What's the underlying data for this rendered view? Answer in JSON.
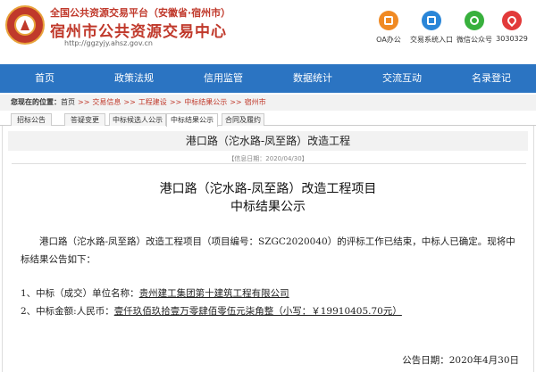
{
  "header": {
    "subtitle": "全国公共资源交易平台（安徽省·宿州市）",
    "title": "宿州市公共资源交易中心",
    "url": "http://ggzyjy.ahsz.gov.cn",
    "quick_links": [
      {
        "label": "OA办公",
        "icon": "office-icon",
        "color": "#f08a24"
      },
      {
        "label": "交易系统入口",
        "icon": "system-icon",
        "color": "#2a86d8"
      },
      {
        "label": "微信公众号",
        "icon": "wechat-icon",
        "color": "#38b03d"
      },
      {
        "label": "3030329",
        "icon": "phone-icon",
        "color": "#e23a3a"
      }
    ]
  },
  "nav": {
    "items": [
      "首页",
      "政策法规",
      "信用监管",
      "数据统计",
      "交流互动",
      "名录登记"
    ],
    "color": "#2b74c2"
  },
  "breadcrumb": {
    "label": "您现在的位置：",
    "items": [
      "首页",
      "交易信息",
      "工程建设",
      "中标结果公示",
      "宿州市"
    ]
  },
  "tabs": [
    "招标公告",
    "答疑变更",
    "中标候选人公示",
    "中标结果公示",
    "合同及履约"
  ],
  "content": {
    "heading": "港口路（沱水路-凤至路）改造工程",
    "info_date": "【信息日期：2020/04/30】",
    "doc_title_line1": "港口路（沱水路-凤至路）改造工程项目",
    "doc_title_line2": "中标结果公示",
    "paragraph": "港口路（沱水路-凤至路）改造工程项目（项目编号：SZGC2020040）的评标工作已结束，中标人已确定。现将中标结果公告如下：",
    "item1_prefix": "1、中标（成交）单位名称：",
    "item1_value": "贵州建工集团第十建筑工程有限公司",
    "item2_prefix": "2、中标金额:人民币：",
    "item2_value": "壹仟玖佰玖拾壹万零肆佰零伍元柒角整（小写：￥19910405.70元）",
    "publish_date": "公告日期：2020年4月30日"
  }
}
